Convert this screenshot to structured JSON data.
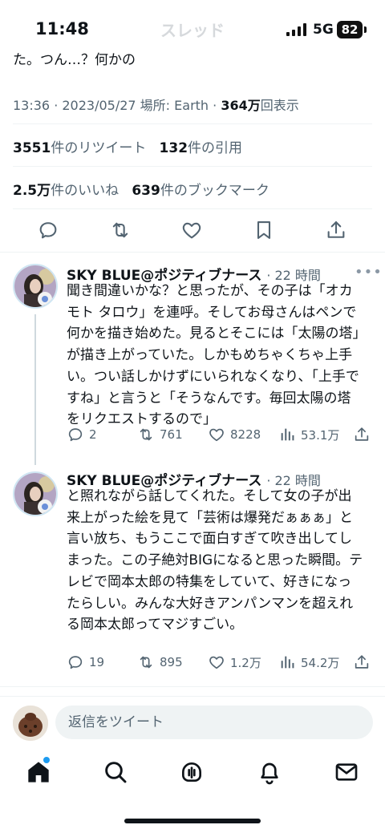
{
  "status_bar": {
    "time": "11:48",
    "ghost_title": "スレッド",
    "network": "5G",
    "battery": "82"
  },
  "tweet": {
    "tail_text": "た。つん…？何かの",
    "timestamp": "13:36 · 2023/05/27 場所: Earth · ",
    "views_count": "364万",
    "views_label": "回表示",
    "retweets_count": "3551",
    "retweets_label": "件のリツイート",
    "quotes_count": "132",
    "quotes_label": "件の引用",
    "likes_count": "2.5万",
    "likes_label": "件のいいね",
    "bookmarks_count": "639",
    "bookmarks_label": "件のブックマーク"
  },
  "replies": [
    {
      "name": "SKY BLUE@ポジティブナース",
      "time": "· 22 時間",
      "text": "聞き間違いかな？と思ったが、その子は「オカモト タロウ」を連呼。そしてお母さんはペンで何かを描き始めた。見るとそこには「太陽の塔」が描き上がっていた。しかもめちゃくちゃ上手い。つい話しかけずにいられなくなり、「上手ですね」と言うと「そうなんです。毎回太陽の塔をリクエストするので」",
      "replies": "2",
      "retweets": "761",
      "likes": "8228",
      "views": "53.1万"
    },
    {
      "name": "SKY BLUE@ポジティブナース",
      "time": "· 22 時間",
      "text": "と照れながら話してくれた。そして女の子が出来上がった絵を見て「芸術は爆発だぁぁぁ」と言い放ち、もうここで面白すぎて吹き出してしまった。この子絶対BIGになると思った瞬間。テレビで岡本太郎の特集をしていて、好きになったらしい。みんな大好きアンパンマンを超えれる岡本太郎ってマジすごい。",
      "replies": "19",
      "retweets": "895",
      "likes": "1.2万",
      "views": "54.2万"
    }
  ],
  "more_glyph": "•••",
  "compose": {
    "placeholder": "返信をツイート"
  },
  "colors": {
    "accent": "#1d9bf0",
    "text": "#0f1419",
    "secondary": "#536471",
    "divider": "#eff3f4"
  },
  "icons": [
    "reply-icon",
    "retweet-icon",
    "like-icon",
    "bookmark-icon",
    "share-icon",
    "views-icon",
    "home-icon",
    "search-icon",
    "spaces-icon",
    "notifications-icon",
    "messages-icon"
  ]
}
